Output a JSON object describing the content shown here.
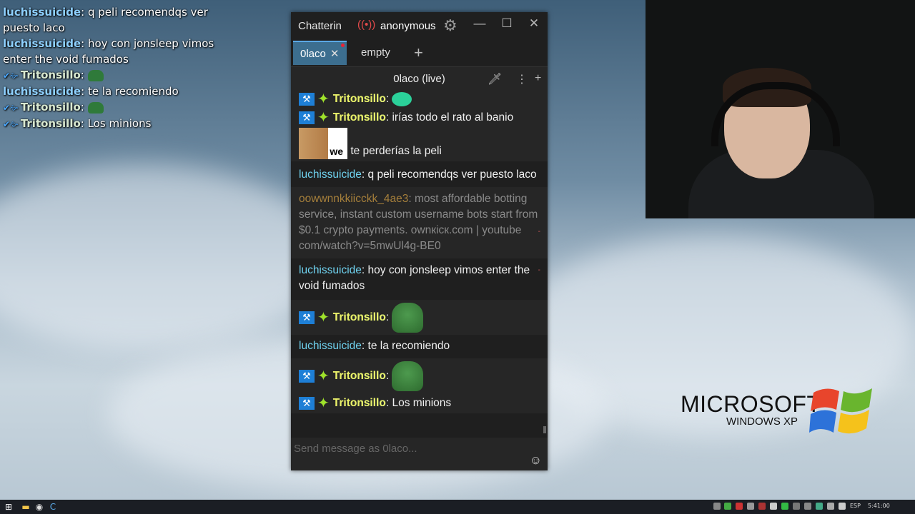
{
  "overlay": {
    "lines": [
      {
        "user": "luchissuicide",
        "text": "q peli recomendqs ver puesto laco"
      },
      {
        "user": "luchissuicide",
        "text": "hoy con jonsleep vimos enter the void fumados"
      },
      {
        "user": "Tritonsillo",
        "text": ""
      },
      {
        "user": "luchissuicide",
        "text": "te la recomiendo"
      },
      {
        "user": "Tritonsillo",
        "text": ""
      },
      {
        "user": "Tritonsillo",
        "text": "Los minions"
      }
    ]
  },
  "window": {
    "app_title": "Chatterin",
    "account": "anonymous",
    "icons": {
      "stream": "live-stream-icon",
      "settings": "gear-icon",
      "minimize": "minimize-icon",
      "maximize": "maximize-icon",
      "close": "close-icon"
    }
  },
  "tabs": [
    {
      "label": "0laco",
      "active": true
    },
    {
      "label": "empty",
      "active": false
    }
  ],
  "channel": {
    "title": "0laco (live)"
  },
  "messages": [
    {
      "user": "Tritonsillo",
      "text": ""
    },
    {
      "user": "Tritonsillo",
      "text": "irías todo el rato al banio"
    },
    {
      "user": "",
      "text": "te perderías la peli",
      "emote_label": "we"
    },
    {
      "user": "luchissuicide",
      "text": "q peli recomendqs ver puesto laco"
    },
    {
      "user": "oowwnnkkiicckk_4ae3",
      "text": "most affordable botting service, instant custom username bots start from $0.1 crypto payments. ownкiск.com | youtube com/watch?v=5mwUl4g-BE0"
    },
    {
      "user": "luchissuicide",
      "text": "hoy con jonsleep vimos enter the void fumados"
    },
    {
      "user": "Tritonsillo",
      "text": ""
    },
    {
      "user": "luchissuicide",
      "text": "te la recomiendo"
    },
    {
      "user": "Tritonsillo",
      "text": ""
    },
    {
      "user": "Tritonsillo",
      "text": "Los minions"
    }
  ],
  "input": {
    "placeholder": "Send message as 0laco..."
  },
  "xp": {
    "brand": "MICROSOFT",
    "edition": "WINDOWS XP"
  },
  "taskbar": {
    "language": "ESP",
    "clock": "5:41:00"
  },
  "colors": {
    "tab_active": "#3c6e8f",
    "user_luchi": "#6fd2ef",
    "user_bot": "#a57f3b",
    "mod_badge": "#1e7fd6"
  }
}
